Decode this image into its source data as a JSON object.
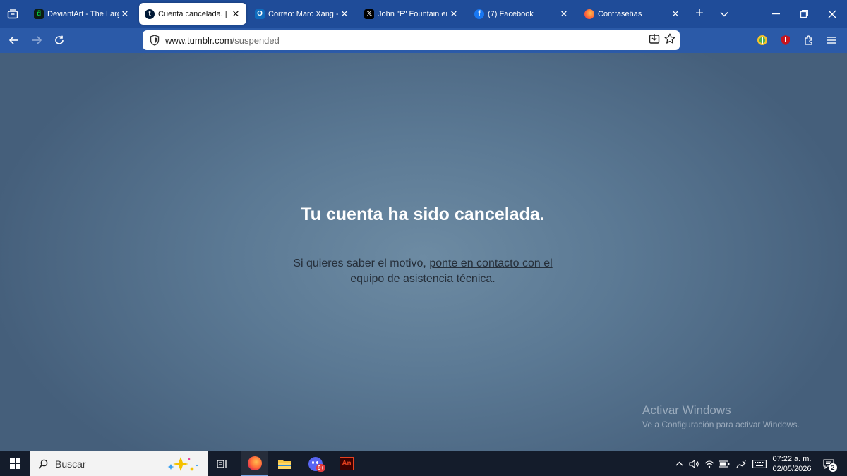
{
  "browser": {
    "tabs": [
      {
        "label": "DeviantArt - The Large",
        "icon": "deviantart-icon"
      },
      {
        "label": "Cuenta cancelada. | Tu",
        "icon": "tumblr-icon"
      },
      {
        "label": "Correo: Marc Xang - O",
        "icon": "outlook-icon"
      },
      {
        "label": "John \"F\" Fountain en X",
        "icon": "x-icon"
      },
      {
        "label": "(7) Facebook",
        "icon": "facebook-icon"
      },
      {
        "label": "Contraseñas",
        "icon": "firefox-icon"
      }
    ],
    "url": {
      "domain": "www.tumblr.com",
      "path": "/suspended"
    }
  },
  "page": {
    "heading": "Tu cuenta ha sido cancelada.",
    "message_prefix": "Si quieres saber el motivo, ",
    "message_link": "ponte en contacto con el equipo de asistencia técnica",
    "message_suffix": ".",
    "watermark_title": "Activar Windows",
    "watermark_sub": "Ve a Configuración para activar Windows."
  },
  "taskbar": {
    "search_placeholder": "Buscar",
    "discord_badge": "9+",
    "time": "07:22 a. m.",
    "date": "02/05/2026",
    "notification_count": "2"
  },
  "colors": {
    "tabbar": "#1f4c99",
    "navbar": "#2b5aa8",
    "page_center": "#6d8ba3",
    "page_edge": "#455f7b",
    "taskbar": "#141c2b"
  }
}
